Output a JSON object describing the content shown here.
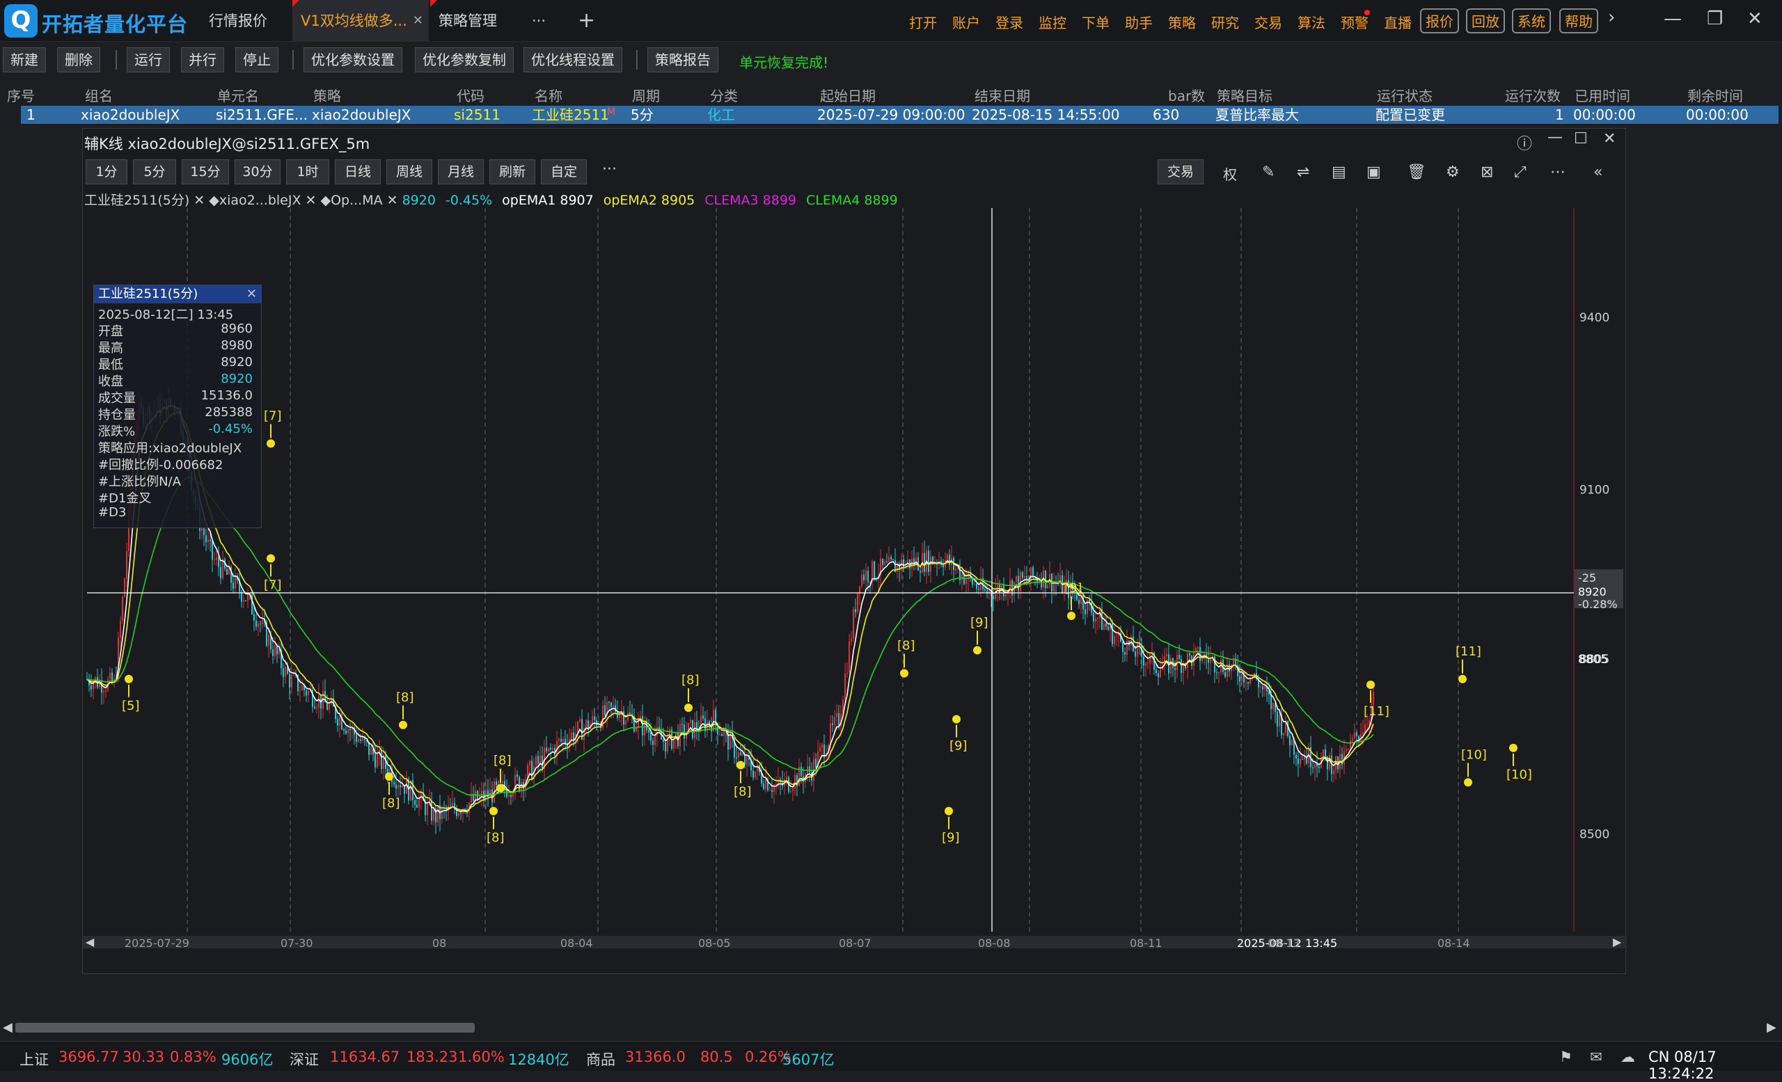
{
  "app": {
    "name": "开拓者量化平台",
    "logo_glyph": "Q"
  },
  "tabs": [
    {
      "label": "行情报价"
    },
    {
      "label": "V1双均线做多..."
    },
    {
      "label": "策略管理"
    }
  ],
  "tab_close": "✕",
  "tab_more": "···",
  "tab_add": "+",
  "menu": [
    "打开",
    "账户",
    "登录",
    "监控",
    "下单",
    "助手",
    "策略",
    "研究",
    "交易",
    "算法",
    "预警",
    "直播"
  ],
  "menu_boxed": [
    "报价",
    "回放",
    "系统",
    "帮助"
  ],
  "window_controls": {
    "arrow": "›",
    "minimize": "—",
    "maximize": "❐",
    "close": "✕"
  },
  "toolbar": {
    "buttons": [
      "新建",
      "删除",
      "运行",
      "并行",
      "停止",
      "优化参数设置",
      "优化参数复制",
      "优化线程设置",
      "策略报告"
    ],
    "status": "单元恢复完成!"
  },
  "table": {
    "headers": [
      "序号",
      "组名",
      "单元名",
      "策略",
      "代码",
      "名称",
      "周期",
      "分类",
      "起始日期",
      "结束日期",
      "bar数",
      "策略目标",
      "运行状态",
      "运行次数",
      "已用时间",
      "剩余时间"
    ],
    "row": {
      "index": "1",
      "group": "xiao2doubleJX",
      "unit": "si2511.GFE...",
      "strategy": "xiao2doubleJX",
      "code": "si2511",
      "name": "工业硅2511",
      "name_flag": "M",
      "period": "5分",
      "category": "化工",
      "start": "2025-07-29 09:00:00",
      "end": "2025-08-15 14:55:00",
      "bars": "630",
      "target": "夏普比率最大",
      "state": "配置已变更",
      "runs": "1",
      "used": "00:00:00",
      "remaining": "00:00:00"
    }
  },
  "subwindow": {
    "title": "辅K线 xiao2doubleJX@si2511.GFEX_5m",
    "periods": [
      "1分",
      "5分",
      "15分",
      "30分",
      "1时",
      "日线",
      "周线",
      "月线",
      "刷新",
      "自定"
    ],
    "more": "···",
    "trade_button": "交易",
    "quan": "权"
  },
  "legend": {
    "items": [
      {
        "text": "工业硅2511(5分) ✕",
        "color": "#d0d0d0"
      },
      {
        "text": "◆xiao2...bleJX ✕",
        "color": "#d0d0d0"
      },
      {
        "text": "◆Op...MA ✕",
        "color": "#d0d0d0"
      },
      {
        "text": "8920",
        "color": "#22d0e0"
      },
      {
        "text": "-0.45%",
        "color": "#22d0e0"
      },
      {
        "text": "opEMA1 8907",
        "color": "#ffffff"
      },
      {
        "text": "opEMA2 8905",
        "color": "#f0f020"
      },
      {
        "text": "CLEMA3 8899",
        "color": "#e020e0"
      },
      {
        "text": "CLEMA4 8899",
        "color": "#20e020"
      }
    ]
  },
  "infobox": {
    "title": "工业硅2511(5分)",
    "datetime": "2025-08-12[二] 13:45",
    "rows": [
      {
        "k": "开盘",
        "v": "8960"
      },
      {
        "k": "最高",
        "v": "8980"
      },
      {
        "k": "最低",
        "v": "8920"
      },
      {
        "k": "收盘",
        "v": "8920"
      },
      {
        "k": "成交量",
        "v": "15136.0"
      },
      {
        "k": "持仓量",
        "v": "285388"
      },
      {
        "k": "涨跌%",
        "v": "-0.45%"
      }
    ],
    "notes": [
      "策略应用:xiao2doubleJX",
      "#回撤比例-0.006682",
      "#上涨比例N/A",
      "#D1金叉",
      "#D3"
    ]
  },
  "chart_data": {
    "type": "candlestick",
    "y_ticks": [
      9400,
      9100,
      8805,
      8500
    ],
    "crosshair": {
      "price": "8920",
      "change": "-25",
      "pct": "-0.28%"
    },
    "last_price_label": "8805",
    "x_labels": [
      "2025-07-29",
      "07-30",
      "08",
      "08-04",
      "08-05",
      "08-07",
      "08-08",
      "08-11",
      "2025-08-12 13:45",
      "08-13",
      "08-14"
    ],
    "signals": [
      "[5]",
      "[7]",
      "[7]",
      "[8]",
      "[8]",
      "[8]",
      "[8]",
      "[8]",
      "[8]",
      "[8]",
      "[9]",
      "[9]",
      "[9]",
      "[9]",
      "[10]",
      "[10]",
      "[11]",
      "[11]"
    ],
    "colors": {
      "up": "#e03030",
      "down": "#20c8d8",
      "ema1": "#ffffff",
      "ema2": "#f0f020",
      "ema4": "#20d020",
      "signal": "#f0e020"
    }
  },
  "statusbar": {
    "items": [
      {
        "t": "上证",
        "c": "#d0d0d0"
      },
      {
        "t": "3696.77",
        "c": "#ff4040"
      },
      {
        "t": "30.33",
        "c": "#ff4040"
      },
      {
        "t": "0.83%",
        "c": "#ff4040"
      },
      {
        "t": "9606亿",
        "c": "#22d0e0"
      },
      {
        "t": "深证",
        "c": "#d0d0d0"
      },
      {
        "t": "11634.67",
        "c": "#ff4040"
      },
      {
        "t": "183.23",
        "c": "#ff4040"
      },
      {
        "t": "1.60%",
        "c": "#ff4040"
      },
      {
        "t": "12840亿",
        "c": "#22d0e0"
      },
      {
        "t": "商品",
        "c": "#d0d0d0"
      },
      {
        "t": "31366.0",
        "c": "#ff4040"
      },
      {
        "t": "80.5",
        "c": "#ff4040"
      },
      {
        "t": "0.26%",
        "c": "#ff4040"
      },
      {
        "t": "5607亿",
        "c": "#22d0e0"
      }
    ],
    "clock": "CN 08/17 13:24:22"
  }
}
